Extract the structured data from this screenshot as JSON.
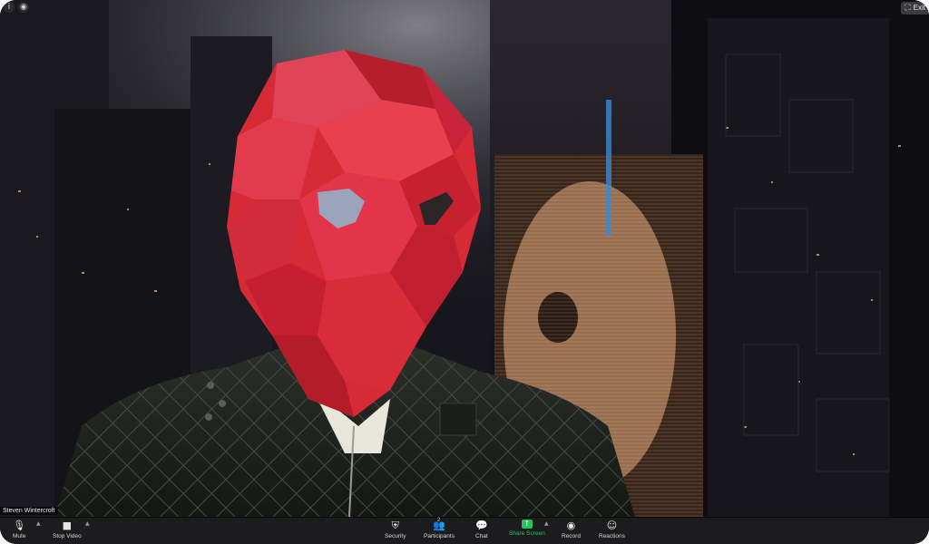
{
  "window": {
    "exit_label": "Exit"
  },
  "participant": {
    "name": "Steven Wintercroft"
  },
  "toolbar": {
    "mute_label": "Mute",
    "stop_video_label": "Stop Video",
    "security_label": "Security",
    "participants_label": "Participants",
    "participants_count": "2",
    "chat_label": "Chat",
    "share_screen_label": "Share Screen",
    "record_label": "Record",
    "reactions_label": "Reactions"
  },
  "icons": {
    "mute": "microphone-icon",
    "video": "video-camera-icon",
    "security": "shield-icon",
    "participants": "people-icon",
    "chat": "speech-bubble-icon",
    "share": "share-screen-icon",
    "record": "record-icon",
    "reactions": "smiley-icon"
  },
  "colors": {
    "toolbar_bg": "#1c1c1e",
    "share_accent": "#23c45e",
    "mask_red": "#d62a36"
  }
}
